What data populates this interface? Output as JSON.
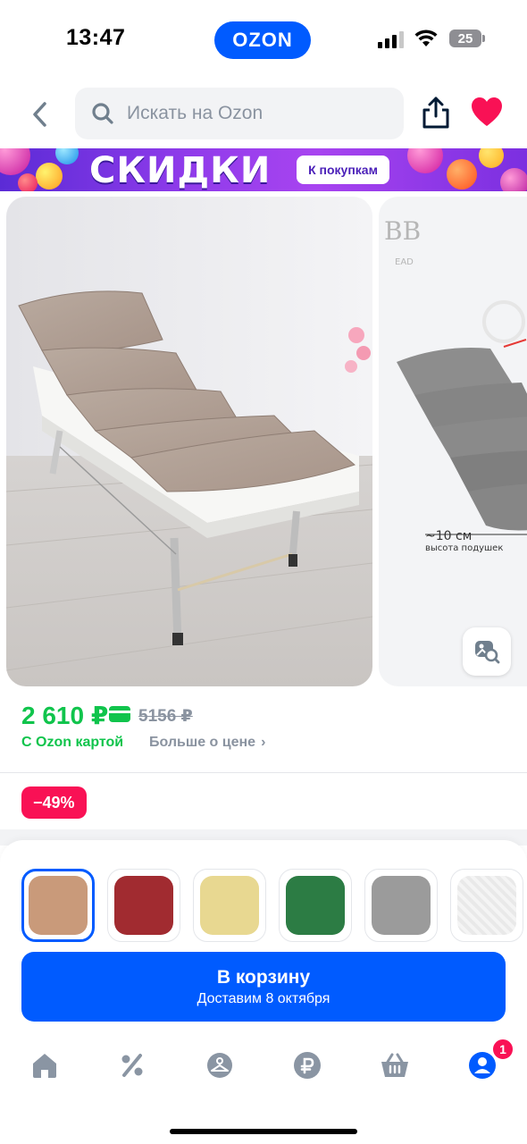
{
  "status_bar": {
    "time": "13:47",
    "app_pill": "OZON",
    "battery": "25"
  },
  "search": {
    "placeholder": "Искать на Ozon"
  },
  "banner": {
    "title": "СКИДКИ",
    "button": "К покупкам"
  },
  "gallery": {
    "second_image": {
      "brand": "BB",
      "brand_sub": "EAD",
      "dimension": "~10 см",
      "caption": "высота подушек"
    }
  },
  "price": {
    "current": "2 610 ₽",
    "old": "5156 ₽",
    "ozon_card_label": "С Ozon картой",
    "more_link": "Больше о цене"
  },
  "discount": "−49%",
  "color_options": [
    {
      "color": "#c99a7a",
      "selected": true
    },
    {
      "color": "#a12b30",
      "selected": false
    },
    {
      "color": "#e8d891",
      "selected": false
    },
    {
      "color": "#2c7c44",
      "selected": false
    },
    {
      "color": "#9b9b9b",
      "selected": false
    },
    {
      "color": "#efefef",
      "selected": false
    }
  ],
  "cart_button": {
    "label": "В корзину",
    "delivery": "Доставим 8 октября"
  },
  "tab_bar": {
    "items": [
      "home-icon",
      "percent-icon",
      "hanger-icon",
      "ruble-icon",
      "basket-icon",
      "profile-icon"
    ],
    "profile_badge": "1"
  },
  "colors": {
    "ozon_blue": "#005bff",
    "green": "#10c44c",
    "sale_red": "#f91155"
  }
}
